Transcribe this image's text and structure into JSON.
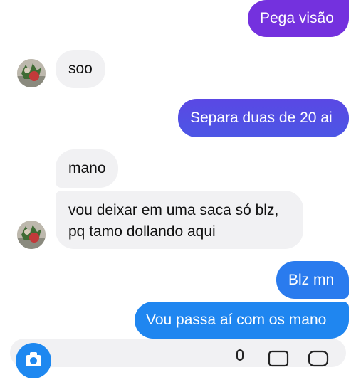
{
  "colors": {
    "incoming_bubble": "#f1f1f3",
    "outgoing_gradient_top": "#7b2ee0",
    "outgoing_gradient_mid": "#4b5ae6",
    "outgoing_gradient_bottom": "#1f86f0",
    "camera_button": "#1e88f0"
  },
  "messages": [
    {
      "sender": "me",
      "text": "Pega visão"
    },
    {
      "sender": "contact",
      "text": "soo"
    },
    {
      "sender": "me",
      "text": "Separa duas de 20 ai"
    },
    {
      "sender": "contact",
      "text": "mano"
    },
    {
      "sender": "contact",
      "lines": [
        "vou deixar em uma saca só blz,",
        "pq tamo dollando aqui"
      ]
    },
    {
      "sender": "me",
      "text": "Blz mn"
    },
    {
      "sender": "me",
      "text": "Vou passa aí com os mano"
    }
  ],
  "composer": {
    "icons": [
      "camera-icon",
      "microphone-icon",
      "image-icon",
      "sticker-icon"
    ]
  }
}
